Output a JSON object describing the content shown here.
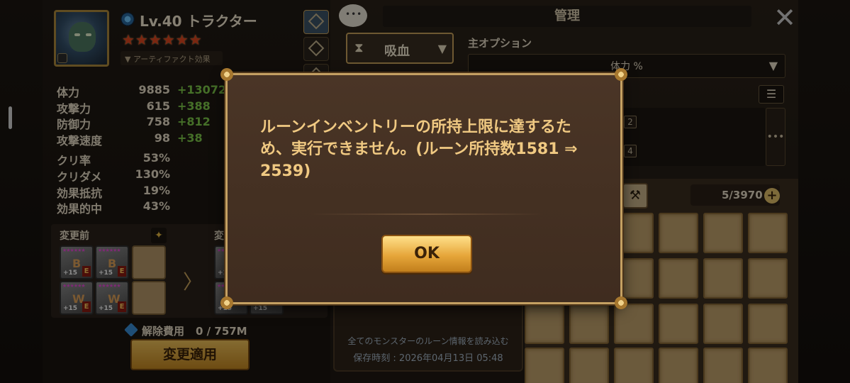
{
  "character": {
    "level_name": "Lv.40 トラクター",
    "stars": "★★★★★★",
    "artifact_effect": "▼ アーティファクト効果",
    "stats": [
      {
        "label": "体力",
        "base": "9885",
        "bonus": "+13072"
      },
      {
        "label": "攻撃力",
        "base": "615",
        "bonus": "+388"
      },
      {
        "label": "防御力",
        "base": "758",
        "bonus": "+812"
      },
      {
        "label": "攻撃速度",
        "base": "98",
        "bonus": "+38"
      }
    ],
    "stats2": [
      {
        "label": "クリ率",
        "value": "53%"
      },
      {
        "label": "クリダメ",
        "value": "130%"
      },
      {
        "label": "効果抵抗",
        "value": "19%"
      },
      {
        "label": "効果的中",
        "value": "43%"
      }
    ]
  },
  "compare": {
    "before_label": "変更前",
    "after_label": "変",
    "rune_stars": "★★★★★★",
    "rune_plus": "+15",
    "rune_grade": "E",
    "arrow": "〉"
  },
  "release_cost": {
    "label": "解除費用",
    "amount": "0 / 757M"
  },
  "apply_button": "変更適用",
  "manage": {
    "title": "管理",
    "close": "✕",
    "set_name": "吸血",
    "main_option_label": "主オプション",
    "main_option_value": "体力 %",
    "sub_numbers": [
      "2",
      "4"
    ],
    "more": "•••",
    "inventory_count": "5/3970",
    "inventory_plus": "+",
    "load_all_text": "全てのモンスターのルーン情報を読み込む",
    "save_time": "保存時刻 : 2026年04月13日 05:48"
  },
  "modal": {
    "message": "ルーンインベントリーの所持上限に達するため、実行できません。(ルーン所持数1581 ⇒ 2539)",
    "ok_label": "OK"
  },
  "colors": {
    "accent_gold": "#c9a25b",
    "bonus_green": "#7fcb4a",
    "modal_text": "#f0c982",
    "star_red": "#e0461e"
  }
}
